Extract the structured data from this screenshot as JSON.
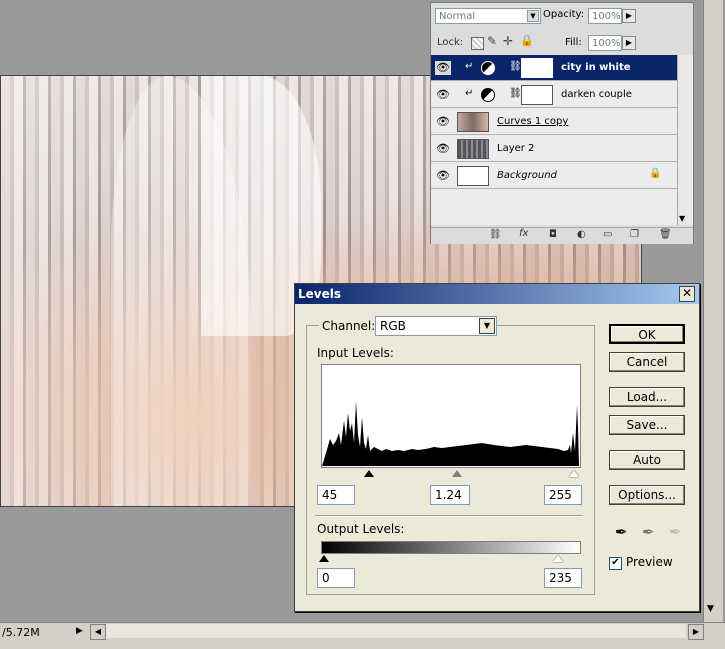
{
  "layers_panel": {
    "blend_mode": "Normal",
    "opacity_label": "Opacity:",
    "opacity_value": "100%",
    "lock_label": "Lock:",
    "fill_label": "Fill:",
    "fill_value": "100%",
    "layers": [
      {
        "name": "city in white",
        "selected": true,
        "type": "adjustment"
      },
      {
        "name": "darken couple",
        "selected": false,
        "type": "adjustment"
      },
      {
        "name": "Curves 1 copy",
        "selected": false,
        "type": "image"
      },
      {
        "name": "Layer 2",
        "selected": false,
        "type": "image"
      },
      {
        "name": "Background",
        "selected": false,
        "type": "background",
        "locked": true
      }
    ]
  },
  "levels_dialog": {
    "title": "Levels",
    "channel_label": "Channel:",
    "channel_value": "RGB",
    "input_levels_label": "Input Levels:",
    "input_black": "45",
    "input_gamma": "1.24",
    "input_white": "255",
    "output_levels_label": "Output Levels:",
    "output_black": "0",
    "output_white": "235",
    "buttons": {
      "ok": "OK",
      "cancel": "Cancel",
      "load": "Load...",
      "save": "Save...",
      "auto": "Auto",
      "options": "Options..."
    },
    "preview_label": "Preview",
    "preview_checked": true
  },
  "status_bar": {
    "doc_size": "/5.72M"
  }
}
